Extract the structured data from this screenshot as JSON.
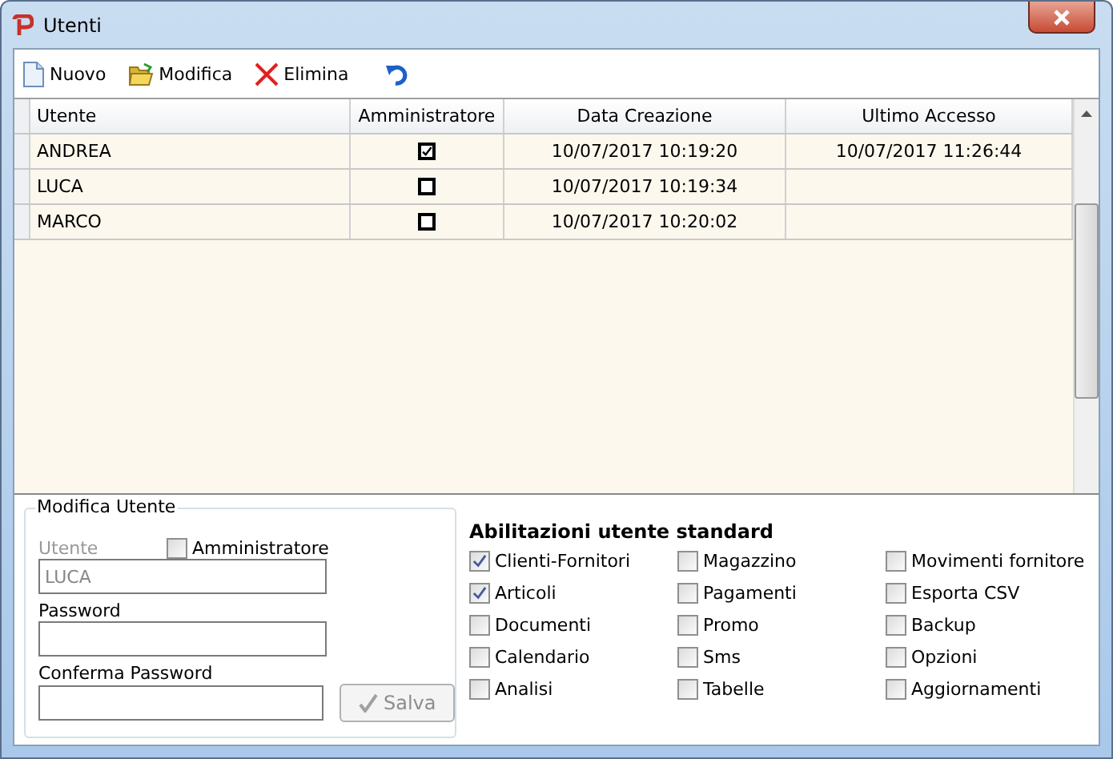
{
  "window": {
    "title": "Utenti"
  },
  "toolbar": [
    {
      "kind": "new",
      "label": "Nuovo"
    },
    {
      "kind": "edit",
      "label": "Modifica"
    },
    {
      "kind": "delete",
      "label": "Elimina"
    },
    {
      "kind": "undo"
    }
  ],
  "table": {
    "columns": [
      "Utente",
      "Amministratore",
      "Data Creazione",
      "Ultimo Accesso"
    ],
    "rows": [
      {
        "user": "ANDREA",
        "admin": true,
        "created": "10/07/2017 10:19:20",
        "last_access": "10/07/2017 11:26:44"
      },
      {
        "user": "LUCA",
        "admin": false,
        "created": "10/07/2017 10:19:34"
      },
      {
        "user": "MARCO",
        "admin": false,
        "created": "10/07/2017 10:20:02"
      }
    ]
  },
  "edit_group": {
    "title": "Modifica Utente",
    "user_label": "Utente",
    "user_value": "LUCA",
    "user_disabled": true,
    "admin": {
      "label": "Amministratore",
      "checked": false
    },
    "password_label": "Password",
    "confirm_label": "Conferma Password",
    "save": {
      "label": "Salva",
      "disabled": true
    },
    "permissions_title": "Abilitazioni utente standard",
    "permissions": [
      {
        "label": "Clienti-Fornitori",
        "checked": true
      },
      {
        "label": "Magazzino",
        "checked": false
      },
      {
        "label": "Movimenti fornitore",
        "checked": false
      },
      {
        "label": "Articoli",
        "checked": true
      },
      {
        "label": "Pagamenti",
        "checked": false
      },
      {
        "label": "Esporta CSV",
        "checked": false
      },
      {
        "label": "Documenti",
        "checked": false
      },
      {
        "label": "Promo",
        "checked": false
      },
      {
        "label": "Backup",
        "checked": false
      },
      {
        "label": "Calendario",
        "checked": false
      },
      {
        "label": "Sms",
        "checked": false
      },
      {
        "label": "Opzioni",
        "checked": false
      },
      {
        "label": "Analisi",
        "checked": false
      },
      {
        "label": "Tabelle",
        "checked": false
      },
      {
        "label": "Aggiornamenti",
        "checked": false
      }
    ]
  }
}
